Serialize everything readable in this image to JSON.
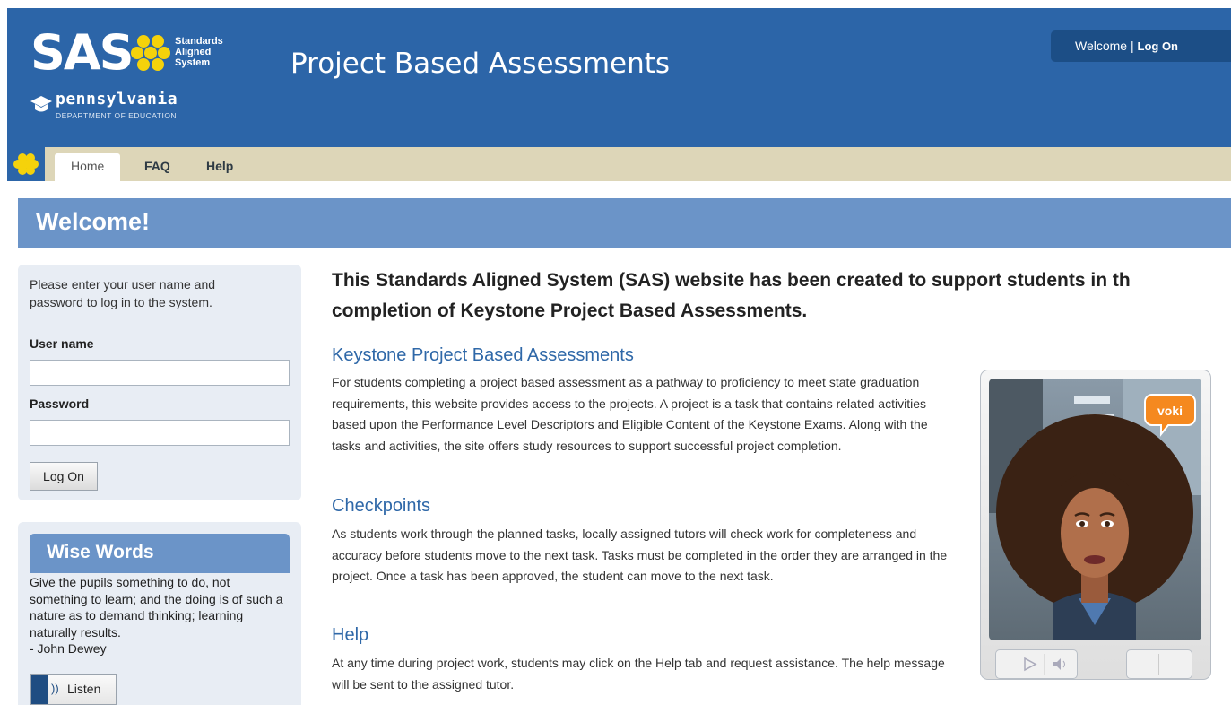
{
  "header": {
    "logo_text": "SAS",
    "logo_tagline": [
      "Standards",
      "Aligned",
      "System"
    ],
    "state_name": "pennsylvania",
    "department": "DEPARTMENT OF EDUCATION",
    "site_title": "Project Based Assessments",
    "welcome_text": "Welcome | ",
    "logon_link": "Log On"
  },
  "nav": {
    "tabs": [
      {
        "label": "Home",
        "active": true
      },
      {
        "label": "FAQ",
        "active": false
      },
      {
        "label": "Help",
        "active": false
      }
    ]
  },
  "banner": {
    "title": "Welcome!"
  },
  "login": {
    "instructions": "Please enter your user name and password to log in to the system.",
    "username_label": "User name",
    "username_value": "",
    "password_label": "Password",
    "password_value": "",
    "submit_label": "Log On"
  },
  "wise_words": {
    "title": "Wise Words",
    "quote": "Give the pupils something to do, not something to learn; and the doing is of such a nature as to demand thinking; learning naturally results.",
    "author": "- John Dewey",
    "listen_label": "Listen"
  },
  "main": {
    "intro": [
      "This Standards Aligned System (SAS) website has been created to support students in th",
      "completion of Keystone Project Based Assessments."
    ],
    "sections": [
      {
        "title": "Keystone Project Based Assessments",
        "body": "For students completing a project based assessment as a pathway to proficiency to meet state graduation requirements, this website provides access to the projects. A project is a task that contains related activities based upon the Performance Level Descriptors and Eligible Content of the Keystone Exams. Along with the tasks and activities, the site offers study resources to support successful project completion."
      },
      {
        "title": "Checkpoints",
        "body": "As students work through the planned tasks, locally assigned tutors will check work for completeness and accuracy before students move to the next task. Tasks must be completed in the order they are arranged in the project. Once a task has been approved, the student can move to the next task."
      },
      {
        "title": "Help",
        "body": "At any time during project work, students may click on the Help tab and request assistance. The help message will be sent to the assigned tutor."
      }
    ]
  },
  "voki": {
    "badge": "voki"
  },
  "colors": {
    "header_blue": "#2c65a8",
    "banner_blue": "#6b94c8",
    "nav_tan": "#ddd6b8",
    "link_blue": "#2f68a8",
    "flower_yellow": "#f5d20b"
  }
}
